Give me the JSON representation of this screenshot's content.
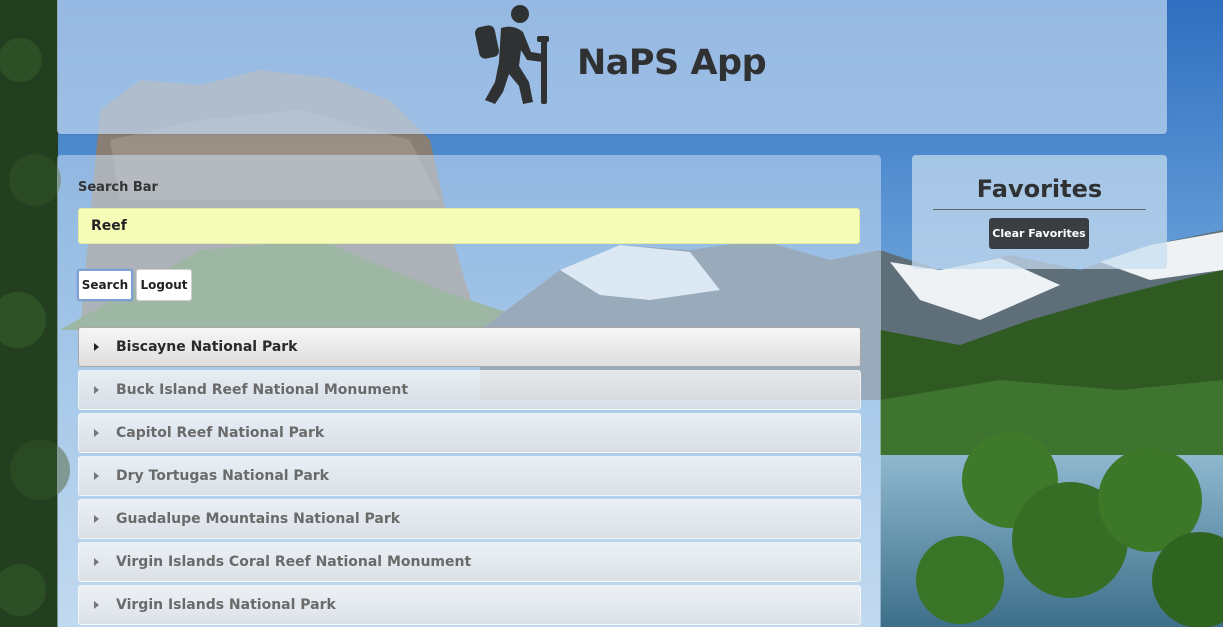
{
  "header": {
    "app_title": "NaPS App",
    "logo_icon": "hiker-icon"
  },
  "search": {
    "label": "Search Bar",
    "value": "Reef",
    "search_button": "Search",
    "logout_button": "Logout"
  },
  "results": [
    {
      "name": "Biscayne National Park",
      "active": true
    },
    {
      "name": "Buck Island Reef National Monument",
      "active": false
    },
    {
      "name": "Capitol Reef National Park",
      "active": false
    },
    {
      "name": "Dry Tortugas National Park",
      "active": false
    },
    {
      "name": "Guadalupe Mountains National Park",
      "active": false
    },
    {
      "name": "Virgin Islands Coral Reef National Monument",
      "active": false
    },
    {
      "name": "Virgin Islands National Park",
      "active": false
    }
  ],
  "favorites": {
    "title": "Favorites",
    "clear_button": "Clear Favorites"
  },
  "colors": {
    "search_input_bg": "#f5fcb8",
    "clear_button_bg": "#3a3d41",
    "panel_tint": "#c8dcf0"
  }
}
